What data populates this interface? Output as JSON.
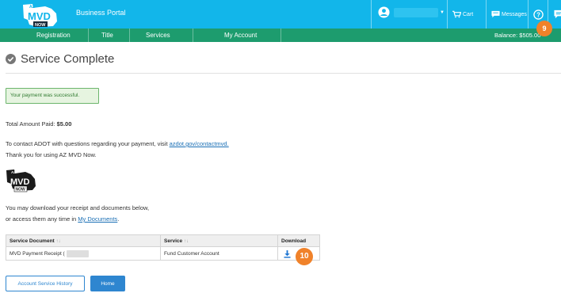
{
  "header": {
    "logo_small_text": "AZ",
    "logo_main": "MVD",
    "logo_sub": "NOW",
    "portal_title": "Business Portal",
    "user_icon": "user-circle-icon",
    "cart_label": "Cart",
    "messages_label": "Messages",
    "help_icon": "help-icon",
    "chat_icon": "chat-icon",
    "brand_color": "#12b6ea"
  },
  "nav": {
    "items": [
      {
        "label": "Registration"
      },
      {
        "label": "Title"
      },
      {
        "label": "Services"
      },
      {
        "label": "My Account"
      }
    ],
    "balance": "Balance: $505.00",
    "nav_color": "#1d9c6e"
  },
  "annotations": {
    "badge_a": "9",
    "badge_b": "10",
    "badge_color": "#f0822a"
  },
  "page": {
    "title": "Service Complete",
    "title_icon": "check-circle-icon",
    "success_message": "Your payment was successful.",
    "total_label": "Total Amount Paid: ",
    "total_value": "$5.00",
    "contact_text": "To contact ADOT with questions regarding your payment, visit ",
    "contact_link": "azdot.gov/contactmvd.",
    "thanks_text": "Thank you for using AZ MVD Now.",
    "download_line1": "You may download your receipt and documents below,",
    "download_line2_prefix": "or access them any time in ",
    "download_link": "My Documents",
    "download_line2_suffix": "."
  },
  "table": {
    "headers": [
      "Service Document",
      "Service",
      "Download"
    ],
    "sort_glyph": "↑↓",
    "rows": [
      {
        "document": "MVD Payment Receipt (",
        "service": "Fund Customer Account",
        "download_icon": "download-icon"
      }
    ]
  },
  "buttons": {
    "history": "Account Service History",
    "home": "Home",
    "primary_color": "#2e86d0"
  }
}
